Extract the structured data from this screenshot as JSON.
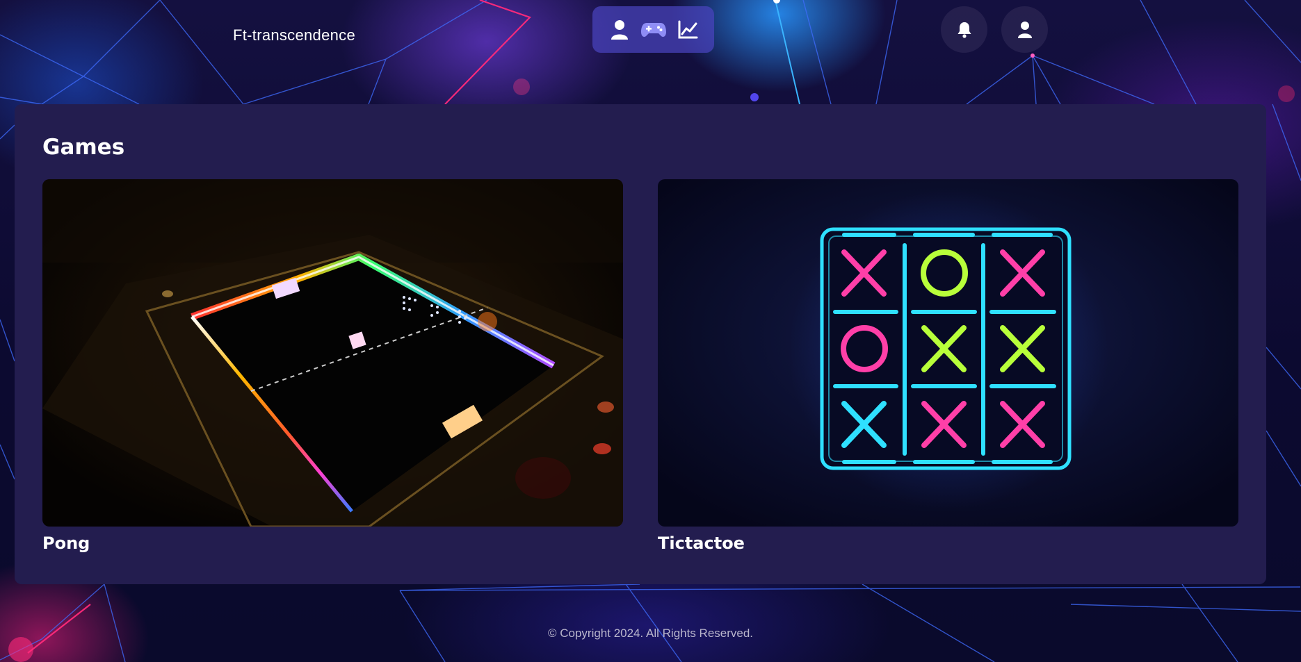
{
  "header": {
    "brand": "Ft-transcendence",
    "nav": [
      {
        "icon": "user-icon"
      },
      {
        "icon": "gamepad-icon"
      },
      {
        "icon": "chart-line-icon"
      }
    ],
    "actions": [
      {
        "icon": "bell-icon"
      },
      {
        "icon": "user-icon"
      }
    ]
  },
  "main": {
    "title": "Games",
    "games": [
      {
        "name": "Pong"
      },
      {
        "name": "Tictactoe"
      }
    ]
  },
  "footer": {
    "copyright": "© Copyright 2024. All Rights Reserved."
  },
  "colors": {
    "panel": "#231d4f",
    "nav_pill": "#4a44be",
    "neon_pink": "#ff3fa8",
    "neon_green": "#b8ff3a",
    "neon_cyan": "#2fe0ff"
  }
}
